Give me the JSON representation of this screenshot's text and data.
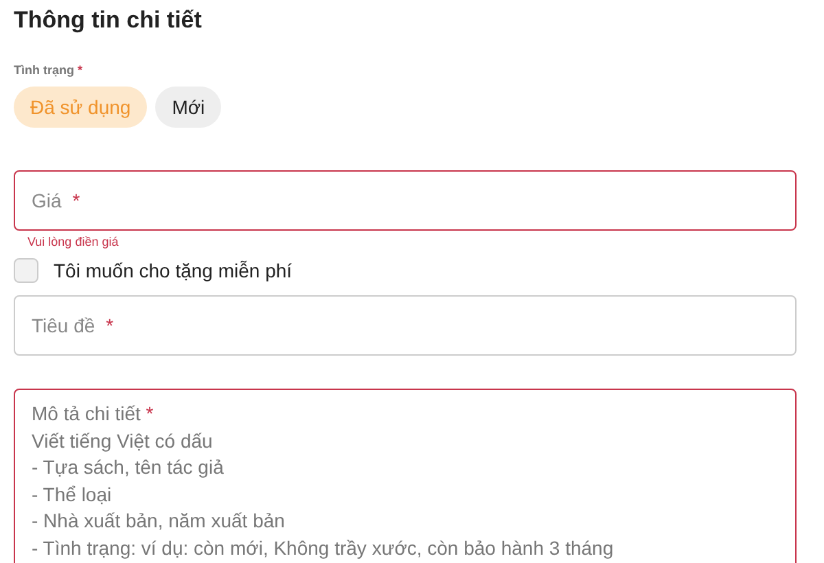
{
  "title": "Thông tin chi tiết",
  "condition": {
    "label": "Tình trạng",
    "required_mark": "*",
    "options": [
      {
        "label": "Đã sử dụng",
        "selected": true
      },
      {
        "label": "Mới",
        "selected": false
      }
    ]
  },
  "price": {
    "placeholder": "Giá",
    "required_mark": "*",
    "error": true,
    "error_text": "Vui lòng điền giá"
  },
  "give_free": {
    "label": "Tôi muốn cho tặng miễn phí",
    "checked": false
  },
  "title_field": {
    "placeholder": "Tiêu đề",
    "required_mark": "*",
    "error": false
  },
  "description": {
    "placeholder": "Mô tả chi tiết",
    "required_mark": "*",
    "error": true,
    "hint_lines": [
      "Viết tiếng Việt có dấu",
      "- Tựa sách, tên tác giả",
      "- Thể loại",
      "- Nhà xuất bản, năm xuất bản",
      "- Tình trạng: ví dụ: còn mới, Không trầy xước, còn bảo hành 3 tháng"
    ]
  }
}
